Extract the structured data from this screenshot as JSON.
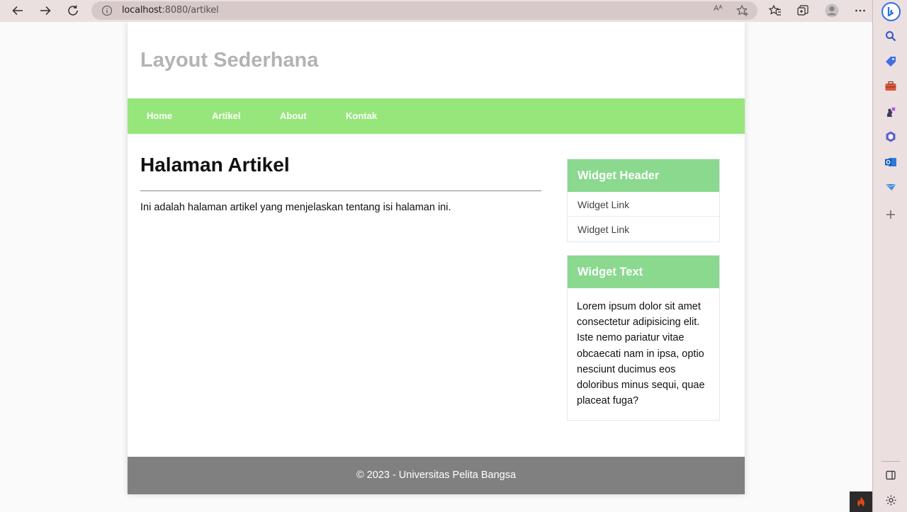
{
  "browser": {
    "url_host": "localhost",
    "url_path": ":8080/artikel",
    "read_aloud_label": "Aᴬ"
  },
  "page": {
    "site_title": "Layout Sederhana",
    "menu": [
      "Home",
      "Artikel",
      "About",
      "Kontak"
    ],
    "article": {
      "title": "Halaman Artikel",
      "body": "Ini adalah halaman artikel yang menjelaskan tentang isi halaman ini."
    },
    "widget_links": {
      "header": "Widget Header",
      "links": [
        "Widget Link",
        "Widget Link"
      ]
    },
    "widget_text": {
      "header": "Widget Text",
      "body": "Lorem ipsum dolor sit amet consectetur adipisicing elit. Iste nemo pariatur vitae obcaecati nam in ipsa, optio nesciunt ducimus eos doloribus minus sequi, quae placeat fuga?"
    },
    "footer": "© 2023 - Universitas Pelita Bangsa"
  },
  "colors": {
    "menu_bg": "#96e67c",
    "widget_header_bg": "#8ad98f",
    "footer_bg": "#808080",
    "title_gray": "#b3b3b3"
  }
}
